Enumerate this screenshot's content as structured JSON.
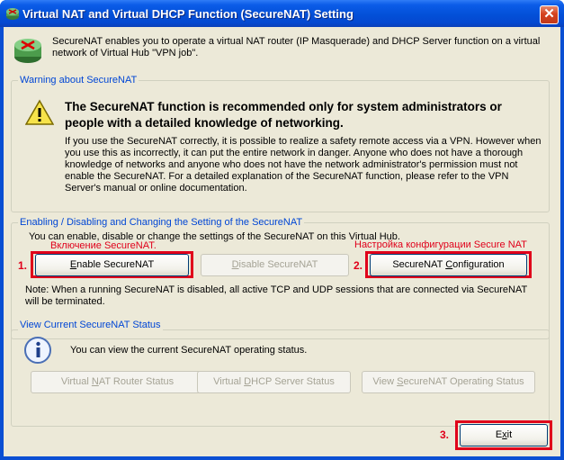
{
  "window": {
    "title": "Virtual NAT and Virtual DHCP Function (SecureNAT) Setting",
    "close_glyph": "✕"
  },
  "intro": {
    "text": "SecureNAT enables you to operate a virtual NAT router (IP Masquerade) and DHCP Server function on a virtual network of Virtual Hub \"VPN job\"."
  },
  "warning_group": {
    "title": "Warning about SecureNAT",
    "headline": "The SecureNAT function is recommended only for system administrators or people with a detailed knowledge of networking.",
    "body": "If you use the SecureNAT correctly, it is possible to realize a safety remote access via a VPN. However when you use this as incorrectly, it can put the entire network in danger. Anyone who does not have a thorough knowledge of networks and anyone who does not have the network administrator's permission must not enable the SecureNAT. For a detailed explanation of the SecureNAT function, please refer to the VPN Server's manual or online documentation."
  },
  "enable_group": {
    "title": "Enabling / Disabling and Changing the Setting of the SecureNAT",
    "description": "You can enable, disable or change the settings of the SecureNAT on this Virtual Hub.",
    "enable_button": {
      "pre": "",
      "accel": "E",
      "post": "nable SecureNAT"
    },
    "disable_button": {
      "pre": "",
      "accel": "D",
      "post": "isable SecureNAT"
    },
    "config_button": {
      "pre": "SecureNAT ",
      "accel": "C",
      "post": "onfiguration"
    },
    "note": "Note: When a running SecureNAT is disabled, all active TCP and UDP sessions that are connected via SecureNAT will be terminated."
  },
  "status_group": {
    "title": "View Current SecureNAT Status",
    "description": "You can view the current SecureNAT operating status.",
    "router_button": {
      "pre": "Virtual ",
      "accel": "N",
      "post": "AT Router Status"
    },
    "dhcp_button": {
      "pre": "Virtual ",
      "accel": "D",
      "post": "HCP Server Status"
    },
    "operating_button": {
      "pre": "View ",
      "accel": "S",
      "post": "ecureNAT Operating Status"
    }
  },
  "exit_button": {
    "pre": "E",
    "accel": "x",
    "post": "it"
  },
  "annotations": {
    "label1": "Включение SecureNAT.",
    "label2": "Настройка конфигурации Secure NAT",
    "num1": "1.",
    "num2": "2.",
    "num3": "3.",
    "color": "#e0001a"
  },
  "icons": {
    "title": "securenat-app-icon",
    "intro": "securenat-router-icon",
    "warning": "warning-triangle-icon",
    "info": "info-icon"
  }
}
